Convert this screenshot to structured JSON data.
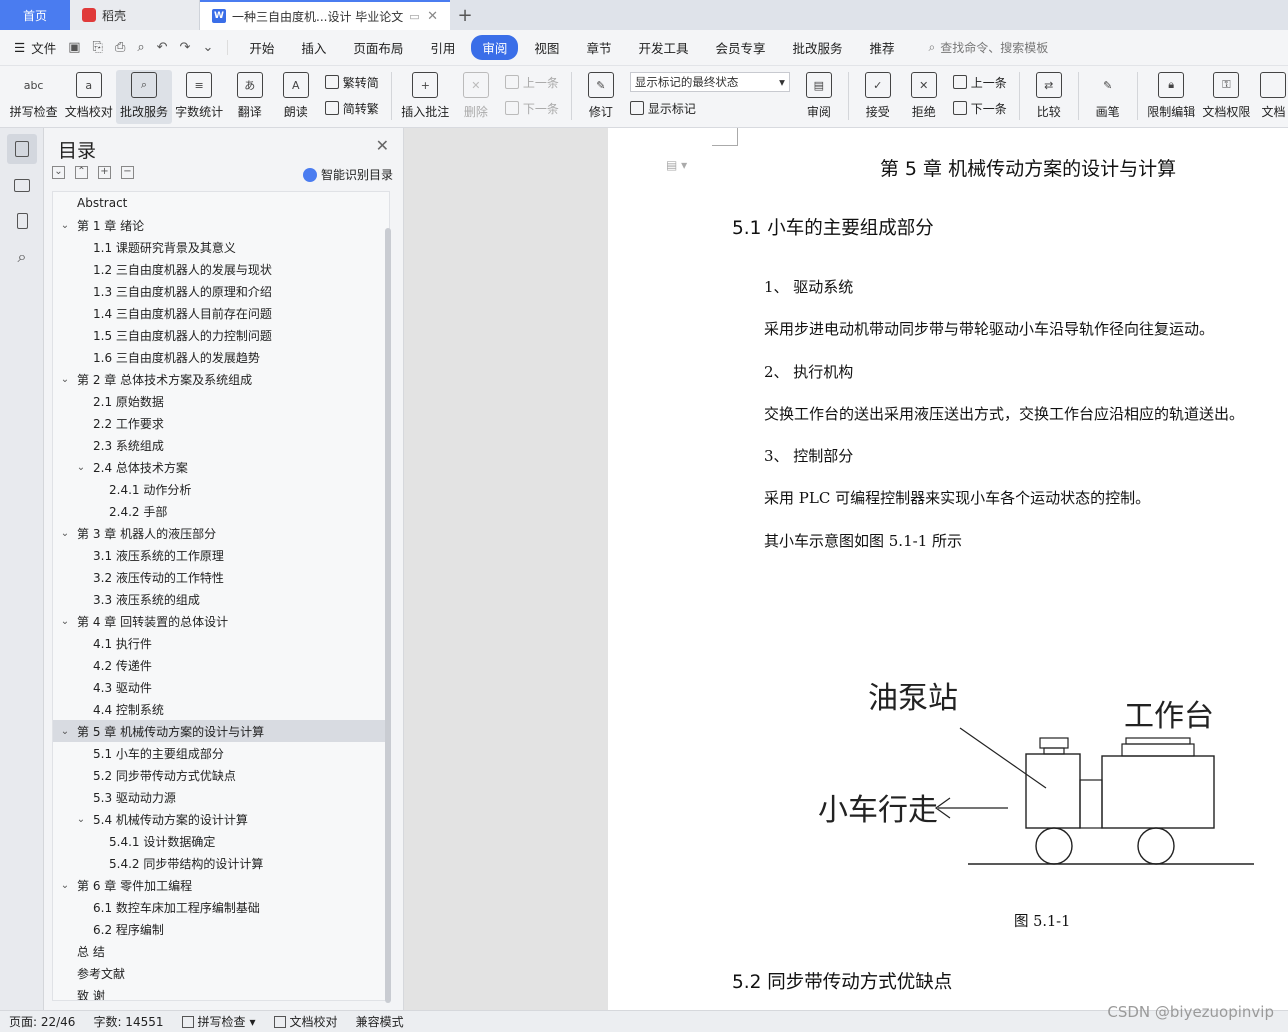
{
  "tabs": {
    "home": "首页",
    "daoke": "稻壳",
    "doc": "一种三自由度机...设计 毕业论文",
    "add": "+"
  },
  "menu": {
    "file": "文件",
    "items": [
      "开始",
      "插入",
      "页面布局",
      "引用",
      "审阅",
      "视图",
      "章节",
      "开发工具",
      "会员专享",
      "批改服务",
      "推荐"
    ],
    "active": "审阅",
    "search": "查找命令、搜索模板"
  },
  "ribbon": {
    "spell": "拼写检查",
    "proof": "文档校对",
    "review_service": "批改服务",
    "wordcount": "字数统计",
    "translate": "翻译",
    "read": "朗读",
    "trad_to_simp": "繁转简",
    "simp_to_trad": "简转繁",
    "insert_comment": "插入批注",
    "delete": "删除",
    "prev": "上一条",
    "next": "下一条",
    "revise": "修订",
    "markup_select": "显示标记的最终状态",
    "show_markup": "显示标记",
    "review": "审阅",
    "accept": "接受",
    "reject": "拒绝",
    "prev2": "上一条",
    "next2": "下一条",
    "compare": "比较",
    "pen": "画笔",
    "restrict": "限制编辑",
    "permission": "文档权限",
    "doc_cut": "文档"
  },
  "toc": {
    "title": "目录",
    "smart": "智能识别目录",
    "items": [
      {
        "label": "Abstract",
        "level": 0,
        "chev": ""
      },
      {
        "label": "第 1 章  绪论",
        "level": 0,
        "chev": "v"
      },
      {
        "label": "1.1 课题研究背景及其意义",
        "level": 1,
        "chev": ""
      },
      {
        "label": "1.2 三自由度机器人的发展与现状",
        "level": 1,
        "chev": ""
      },
      {
        "label": "1.3 三自由度机器人的原理和介绍",
        "level": 1,
        "chev": ""
      },
      {
        "label": "1.4 三自由度机器人目前存在问题",
        "level": 1,
        "chev": ""
      },
      {
        "label": "1.5 三自由度机器人的力控制问题",
        "level": 1,
        "chev": ""
      },
      {
        "label": "1.6 三自由度机器人的发展趋势",
        "level": 1,
        "chev": ""
      },
      {
        "label": "第 2 章  总体技术方案及系统组成",
        "level": 0,
        "chev": "v"
      },
      {
        "label": "2.1 原始数据",
        "level": 1,
        "chev": ""
      },
      {
        "label": "2.2 工作要求",
        "level": 1,
        "chev": ""
      },
      {
        "label": "2.3 系统组成",
        "level": 1,
        "chev": ""
      },
      {
        "label": "2.4 总体技术方案",
        "level": 1,
        "chev": "v"
      },
      {
        "label": "2.4.1  动作分析",
        "level": 2,
        "chev": ""
      },
      {
        "label": "2.4.2  手部",
        "level": 2,
        "chev": ""
      },
      {
        "label": "第 3 章  机器人的液压部分",
        "level": 0,
        "chev": "v"
      },
      {
        "label": "3.1 液压系统的工作原理",
        "level": 1,
        "chev": ""
      },
      {
        "label": "3.2 液压传动的工作特性",
        "level": 1,
        "chev": ""
      },
      {
        "label": "3.3 液压系统的组成",
        "level": 1,
        "chev": ""
      },
      {
        "label": "第 4 章  回转装置的总体设计",
        "level": 0,
        "chev": "v"
      },
      {
        "label": "4.1 执行件",
        "level": 1,
        "chev": ""
      },
      {
        "label": "4.2 传递件",
        "level": 1,
        "chev": ""
      },
      {
        "label": "4.3 驱动件",
        "level": 1,
        "chev": ""
      },
      {
        "label": "4.4 控制系统",
        "level": 1,
        "chev": ""
      },
      {
        "label": "第 5 章  机械传动方案的设计与计算",
        "level": 0,
        "chev": "v",
        "selected": true
      },
      {
        "label": "5.1 小车的主要组成部分",
        "level": 1,
        "chev": ""
      },
      {
        "label": "5.2 同步带传动方式优缺点",
        "level": 1,
        "chev": ""
      },
      {
        "label": "5.3 驱动动力源",
        "level": 1,
        "chev": ""
      },
      {
        "label": "5.4 机械传动方案的设计计算",
        "level": 1,
        "chev": "v"
      },
      {
        "label": "5.4.1 设计数据确定",
        "level": 2,
        "chev": ""
      },
      {
        "label": "5.4.2 同步带结构的设计计算",
        "level": 2,
        "chev": ""
      },
      {
        "label": "第 6 章  零件加工编程",
        "level": 0,
        "chev": "v"
      },
      {
        "label": "6.1 数控车床加工程序编制基础",
        "level": 1,
        "chev": ""
      },
      {
        "label": "6.2 程序编制",
        "level": 1,
        "chev": ""
      },
      {
        "label": "总    结",
        "level": 0,
        "chev": ""
      },
      {
        "label": "参考文献",
        "level": 0,
        "chev": ""
      },
      {
        "label": "致    谢",
        "level": 0,
        "chev": ""
      }
    ]
  },
  "doc": {
    "chapter_title": "第 5 章  机械传动方案的设计与计算",
    "section1": "5.1 小车的主要组成部分",
    "item1": "1、  驱动系统",
    "para1": "采用步进电动机带动同步带与带轮驱动小车沿导轨作径向往复运动。",
    "item2": "2、  执行机构",
    "para2": "交换工作台的送出采用液压送出方式，交换工作台应沿相应的轨道送出。",
    "item3": "3、  控制部分",
    "para3": "采用 PLC 可编程控制器来实现小车各个运动状态的控制。",
    "para4": "其小车示意图如图 5.1-1 所示",
    "figure": {
      "pump_label": "油泵站",
      "table_label": "工作台",
      "travel_label": "小车行走"
    },
    "caption": "图 5.1-1",
    "section2": "5.2 同步带传动方式优缺点"
  },
  "status": {
    "page": "页面: 22/46",
    "words": "字数: 14551",
    "spell": "拼写检查",
    "proof": "文档校对",
    "compat": "兼容模式"
  },
  "watermark": "CSDN @biyezuopinvip"
}
